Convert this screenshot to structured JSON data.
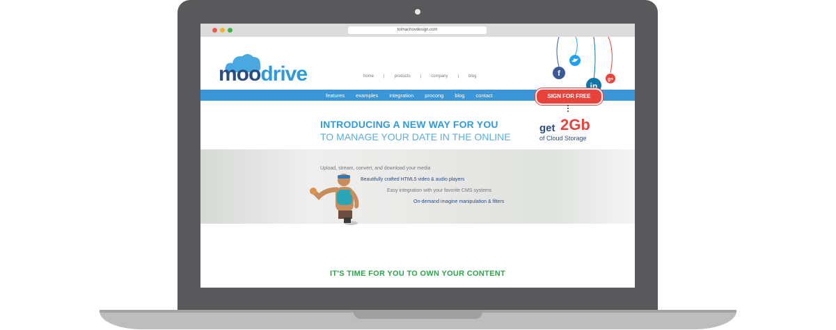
{
  "browser": {
    "url": "tolmachovdesign.com"
  },
  "logo": {
    "part1": "moo",
    "part2": "drive"
  },
  "top_nav": [
    "home",
    "|",
    "products",
    "|",
    "company",
    "|",
    "blog"
  ],
  "main_nav": [
    "features",
    "examples",
    "integration",
    "procong",
    "blog",
    "contact"
  ],
  "signup_label": "SIGN FOR FREE",
  "intro": {
    "line1": "INTRODUCING A NEW WAY FOR YOU",
    "line2": "TO MANAGE YOUR DATE IN THE ONLINE"
  },
  "promo": {
    "get": "get",
    "amount": "2Gb",
    "sub": "of Cloud Storage"
  },
  "features": [
    "Upload, stream, convert, and download your media",
    "Beautifully crafted HTML5 video & audio players",
    "Easy integration with your favorite CMS systems",
    "On-demand imagine manipulation & filters"
  ],
  "bottom_title": "IT'S TIME FOR YOU TO OWN YOUR CONTENT",
  "social_icons": [
    "facebook-icon",
    "twitter-icon",
    "linkedin-icon",
    "google-plus-icon"
  ],
  "colors": {
    "accent": "#3a96d6",
    "brand_dark": "#2b4c7e",
    "cta": "#e8423b",
    "green": "#2da44e"
  }
}
